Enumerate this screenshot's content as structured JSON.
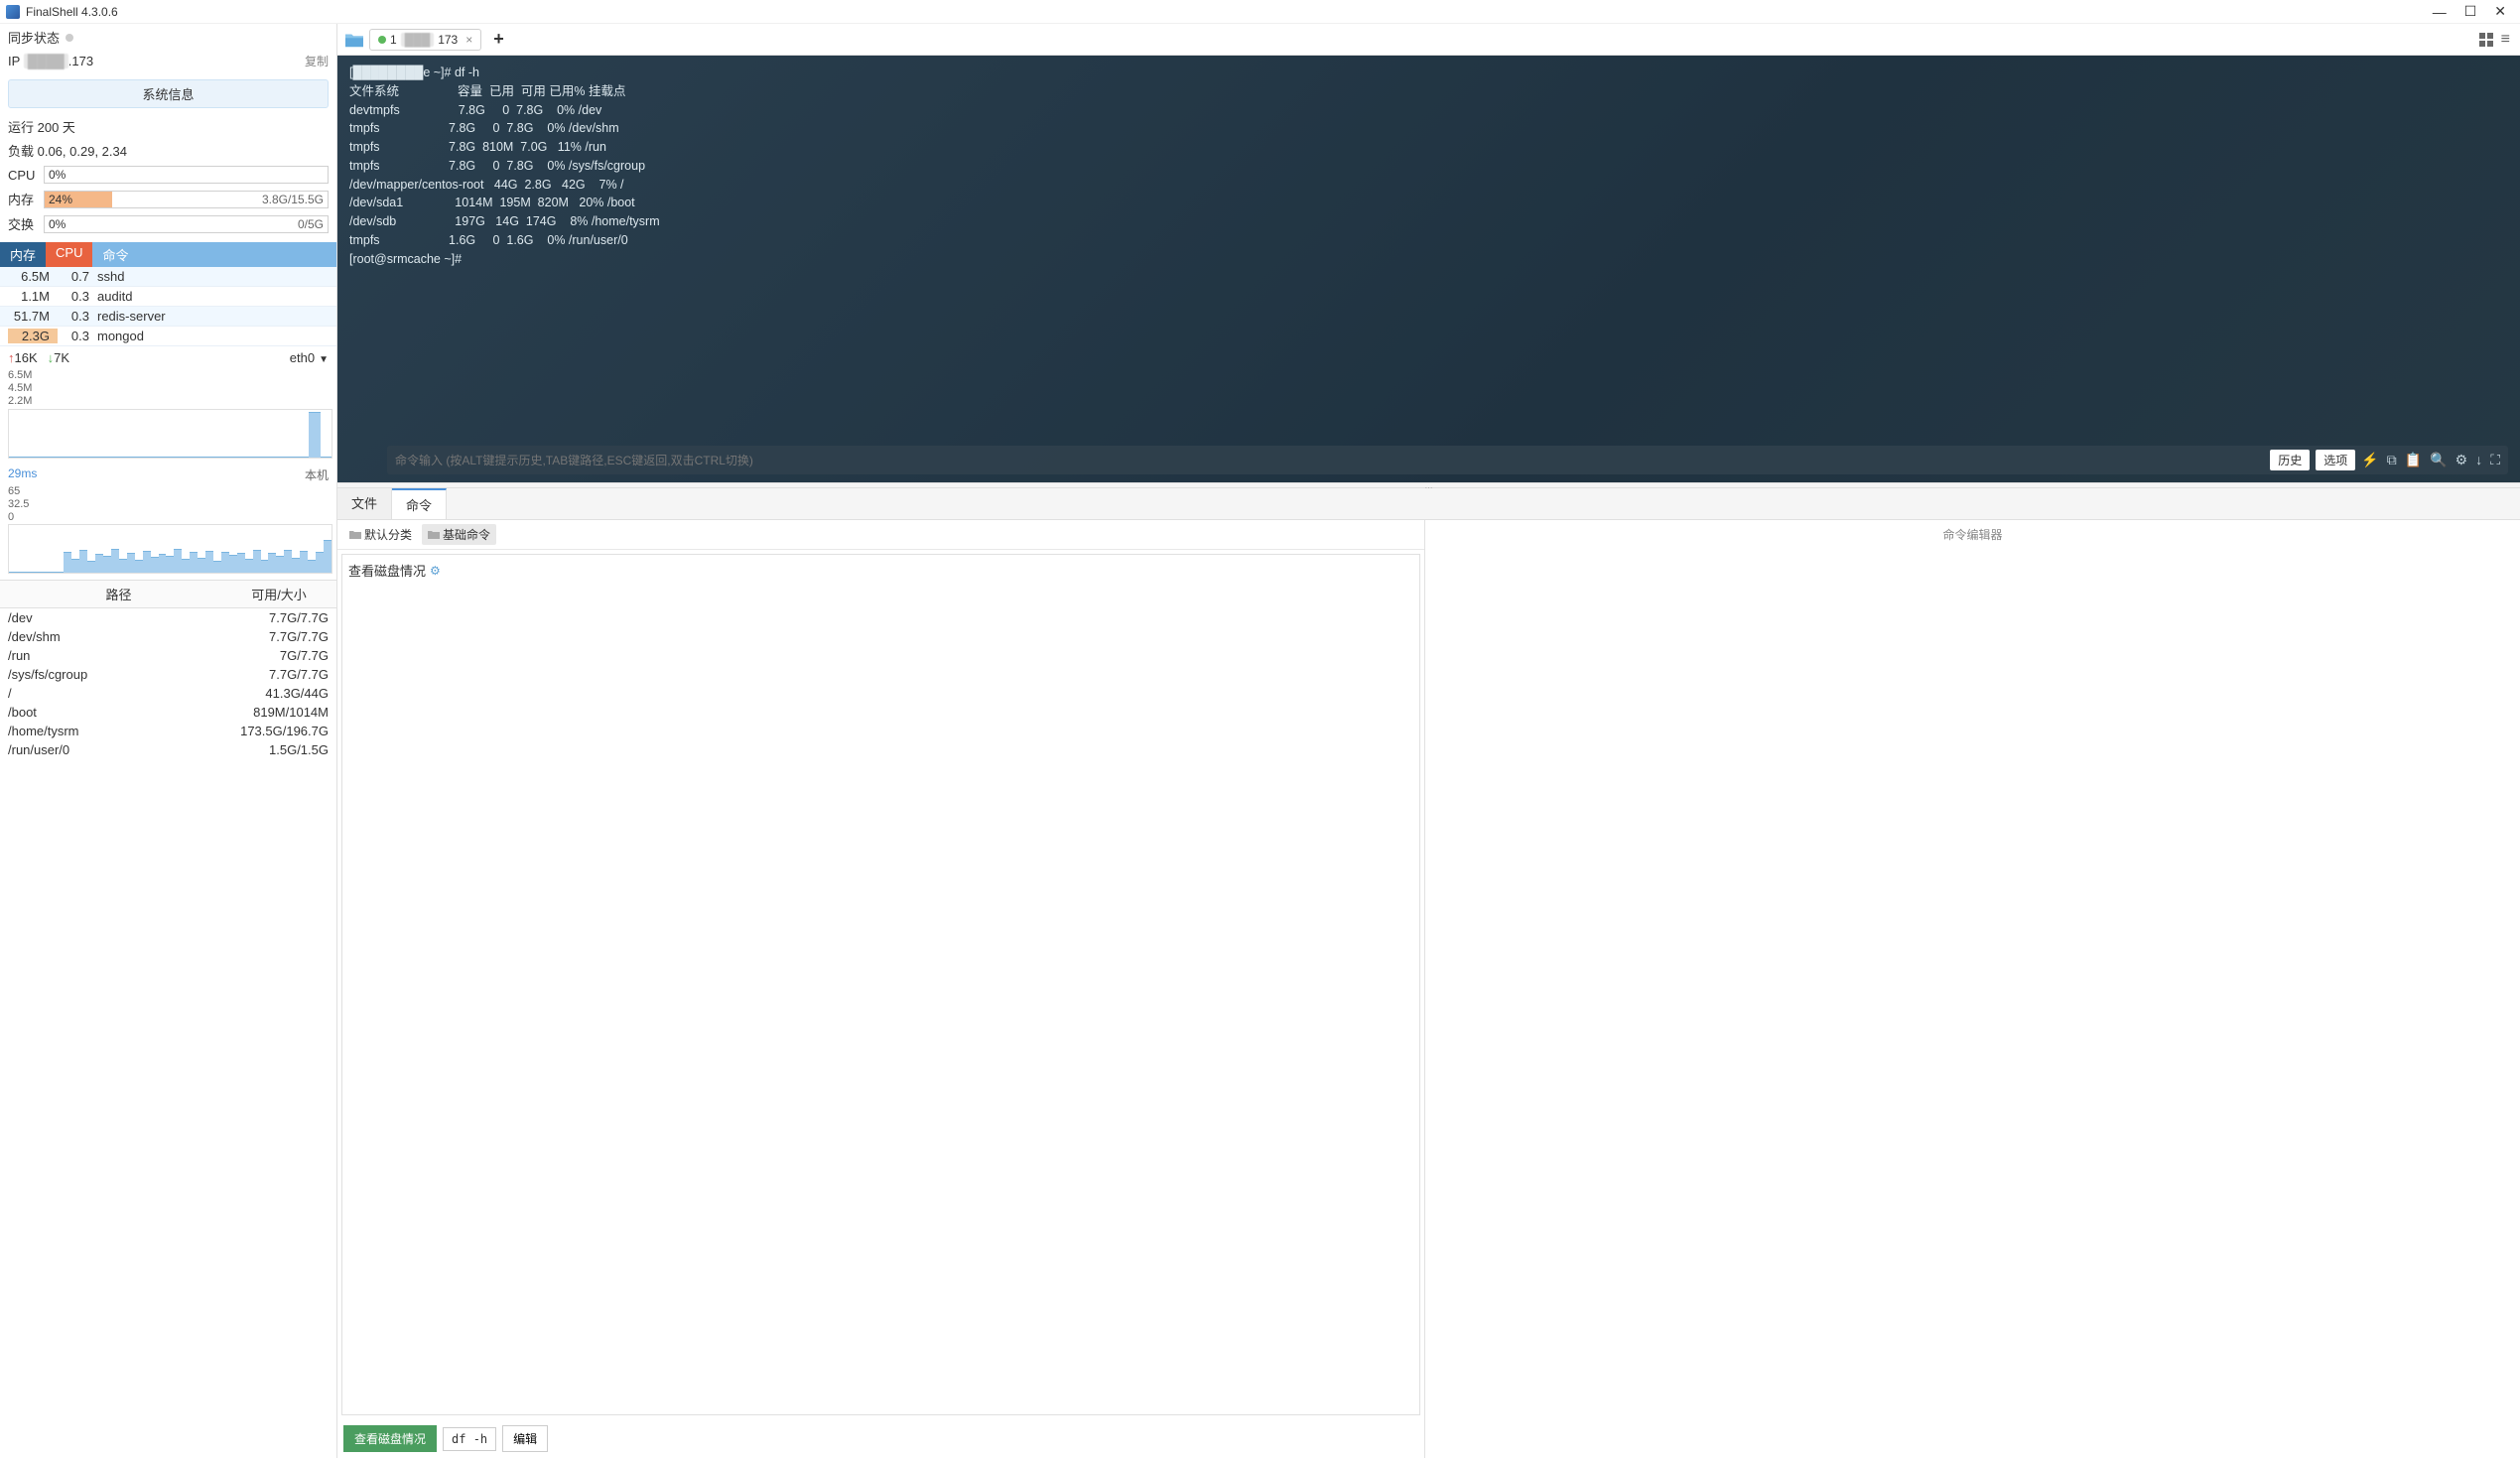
{
  "titlebar": {
    "title": "FinalShell 4.3.0.6"
  },
  "sidebar": {
    "sync_label": "同步状态",
    "ip_prefix": "IP",
    "ip_blur": "████",
    "ip_suffix": ".173",
    "copy_label": "复制",
    "sysinfo_btn": "系统信息",
    "uptime": "运行 200 天",
    "load": "负载 0.06, 0.29, 2.34",
    "cpu_label": "CPU",
    "cpu_pct": "0%",
    "mem_label": "内存",
    "mem_pct": "24%",
    "mem_detail": "3.8G/15.5G",
    "swap_label": "交换",
    "swap_pct": "0%",
    "swap_detail": "0/5G",
    "proc_tabs": {
      "mem": "内存",
      "cpu": "CPU",
      "cmd": "命令"
    },
    "processes": [
      {
        "mem": "6.5M",
        "cpu": "0.7",
        "name": "sshd"
      },
      {
        "mem": "1.1M",
        "cpu": "0.3",
        "name": "auditd"
      },
      {
        "mem": "51.7M",
        "cpu": "0.3",
        "name": "redis-server"
      },
      {
        "mem": "2.3G",
        "cpu": "0.3",
        "name": "mongod"
      }
    ],
    "net_up": "16K",
    "net_down": "7K",
    "net_if": "eth0",
    "net_ylabels": [
      "6.5M",
      "4.5M",
      "2.2M"
    ],
    "latency": "29ms",
    "latency_host": "本机",
    "latency_ylabels": [
      "65",
      "32.5",
      "0"
    ],
    "disk_header": {
      "path": "路径",
      "size": "可用/大小"
    },
    "disks": [
      {
        "path": "/dev",
        "size": "7.7G/7.7G"
      },
      {
        "path": "/dev/shm",
        "size": "7.7G/7.7G"
      },
      {
        "path": "/run",
        "size": "7G/7.7G"
      },
      {
        "path": "/sys/fs/cgroup",
        "size": "7.7G/7.7G"
      },
      {
        "path": "/",
        "size": "41.3G/44G"
      },
      {
        "path": "/boot",
        "size": "819M/1014M"
      },
      {
        "path": "/home/tysrm",
        "size": "173.5G/196.7G"
      },
      {
        "path": "/run/user/0",
        "size": "1.5G/1.5G"
      }
    ]
  },
  "tabbar": {
    "tab_num": "1",
    "tab_host_blur": "███",
    "tab_host_suffix": "173"
  },
  "terminal": {
    "lines": [
      "[████████e ~]# df -h",
      "文件系统                 容量  已用  可用 已用% 挂载点",
      "devtmpfs                 7.8G     0  7.8G    0% /dev",
      "tmpfs                    7.8G     0  7.8G    0% /dev/shm",
      "tmpfs                    7.8G  810M  7.0G   11% /run",
      "tmpfs                    7.8G     0  7.8G    0% /sys/fs/cgroup",
      "/dev/mapper/centos-root   44G  2.8G   42G    7% /",
      "/dev/sda1               1014M  195M  820M   20% /boot",
      "/dev/sdb                 197G   14G  174G    8% /home/tysrm",
      "tmpfs                    1.6G     0  1.6G    0% /run/user/0",
      "[root@srmcache ~]#"
    ],
    "input_placeholder": "命令输入 (按ALT键提示历史,TAB键路径,ESC键返回,双击CTRL切换)",
    "history_btn": "历史",
    "options_btn": "选项"
  },
  "bottom": {
    "tab_file": "文件",
    "tab_cmd": "命令",
    "cat_default": "默认分类",
    "cat_basic": "基础命令",
    "cmd_item": "查看磁盘情况",
    "editor_title": "命令编辑器",
    "exec_btn": "查看磁盘情况",
    "cmd_text": "df -h",
    "edit_btn": "编辑"
  },
  "chart_data": [
    {
      "type": "area",
      "title": "network",
      "ylabel": "",
      "ylim": [
        0,
        6500000
      ],
      "y_ticks": [
        "2.2M",
        "4.5M",
        "6.5M"
      ],
      "series": [
        {
          "name": "up",
          "current": "16K"
        },
        {
          "name": "down",
          "current": "7K"
        }
      ],
      "note": "historical waveform not numerically labeled; single spike near right edge"
    },
    {
      "type": "bar",
      "title": "latency",
      "ylabel": "ms",
      "ylim": [
        0,
        65
      ],
      "y_ticks": [
        "0",
        "32.5",
        "65"
      ],
      "current": 29,
      "note": "jittery bars roughly between 15 and 45 ms across window"
    }
  ]
}
